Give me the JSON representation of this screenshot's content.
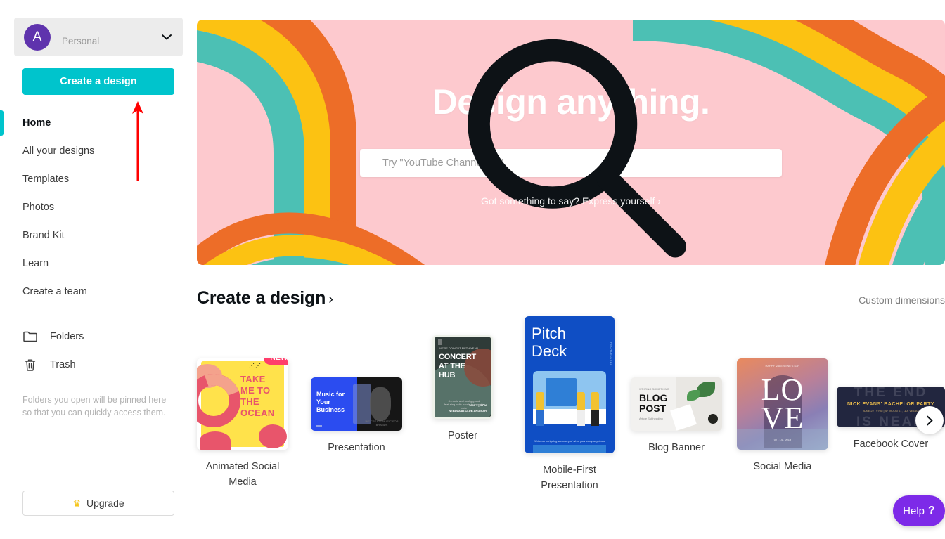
{
  "sidebar": {
    "account": {
      "avatar_initial": "A",
      "label": "Personal",
      "chevron_icon": "chevron-down-icon"
    },
    "create_design_button": "Create a design",
    "nav_items": [
      {
        "label": "Home",
        "active": true
      },
      {
        "label": "All your designs",
        "active": false
      },
      {
        "label": "Templates",
        "active": false
      },
      {
        "label": "Photos",
        "active": false
      },
      {
        "label": "Brand Kit",
        "active": false
      },
      {
        "label": "Learn",
        "active": false
      },
      {
        "label": "Create a team",
        "active": false
      }
    ],
    "nav_icon_items": [
      {
        "label": "Folders",
        "icon": "folder-icon"
      },
      {
        "label": "Trash",
        "icon": "trash-icon"
      }
    ],
    "pinned_note": "Folders you open will be pinned here so that you can quickly access them.",
    "upgrade_button": {
      "label": "Upgrade",
      "icon": "crown-icon"
    }
  },
  "hero": {
    "title": "Design anything.",
    "search": {
      "placeholder": "Try \"YouTube Channel Art\"",
      "value": "",
      "icon": "search-icon"
    },
    "link": "Got something to say? Express yourself ›",
    "background_color": "#fdc9ce",
    "stripe_colors": {
      "teal": "#4cc0b4",
      "yellow": "#fcc212",
      "orange": "#ed6d28"
    }
  },
  "section": {
    "title": "Create a design",
    "title_caret": "›",
    "custom_dimensions": "Custom dimensions",
    "carousel_next_icon": "chevron-right-icon"
  },
  "cards": [
    {
      "label": "Animated Social\nMedia",
      "badge": "NEW",
      "thumb_text": [
        "TAKE",
        "ME TO",
        "THE",
        "OCEAN"
      ]
    },
    {
      "label": "Presentation",
      "badge": null,
      "thumb_text": [
        "Music for",
        "Your",
        "Business"
      ]
    },
    {
      "label": "Poster",
      "badge": null,
      "thumb_text": [
        "WE'RE DOING IT FIFTH YEAR",
        "CONCERT",
        "AT THE",
        "HUB",
        "A music and soul gig and featuring indie bands & acoustic acts",
        "MAY 1 | 4 PM",
        "NEBULA 88 CLUB AND BAR"
      ]
    },
    {
      "label": "Mobile-First\nPresentation",
      "badge": null,
      "thumb_text": [
        "Pitch",
        "Deck",
        "Write an intriguing summary of what your company does",
        "PITCH DECK | 1.0"
      ]
    },
    {
      "label": "Blog Banner",
      "badge": null,
      "thumb_text": [
        "WRITING SOMETHING",
        "BLOG",
        "POST",
        "Article Subheading"
      ]
    },
    {
      "label": "Social Media",
      "badge": null,
      "thumb_text": [
        "HAPPY VALENTINE'S DAY",
        "LO",
        "VE",
        "02 . 14 . 2019"
      ]
    },
    {
      "label": "Facebook Cover",
      "badge": null,
      "thumb_text": [
        "THE END",
        "NICK EVANS' BACHELOR PARTY",
        "JUNE 22 | 9 PM | 47 MOON ST, LAS VEGAS",
        "IS NEAR"
      ]
    }
  ],
  "help": {
    "label": "Help",
    "mark": "?",
    "color": "#7d2ae8"
  },
  "annotation": {
    "arrow_color": "#ff0000",
    "arrow_direction": "up"
  }
}
